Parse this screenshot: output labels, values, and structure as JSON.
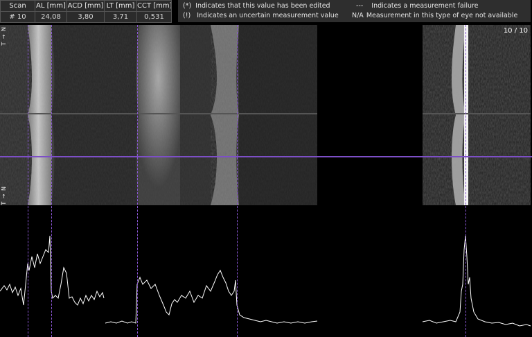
{
  "table": {
    "headers": [
      "Scan",
      "AL [mm]",
      "ACD [mm]",
      "LT [mm]",
      "CCT [mm]"
    ],
    "row": [
      "# 10",
      "24,08",
      "3,80",
      "3,71",
      "0,531"
    ]
  },
  "legend": {
    "edited_symbol": "(*)",
    "edited_text": "Indicates that this value has been edited",
    "uncertain_symbol": "(!)",
    "uncertain_text": "Indicates an uncertain measurement value",
    "failure_symbol": "---",
    "failure_text": "Indicates a measurement failure",
    "na_symbol": "N/A",
    "na_text": "Measurement in this type of eye not available"
  },
  "scan_counter": "10 / 10",
  "orientation_top": "T → N",
  "orientation_bottom": "T → N",
  "colors": {
    "marker_line": "#8b57d6",
    "table_bg": "#2b2b2b",
    "legend_bg": "#2e2e2e"
  }
}
